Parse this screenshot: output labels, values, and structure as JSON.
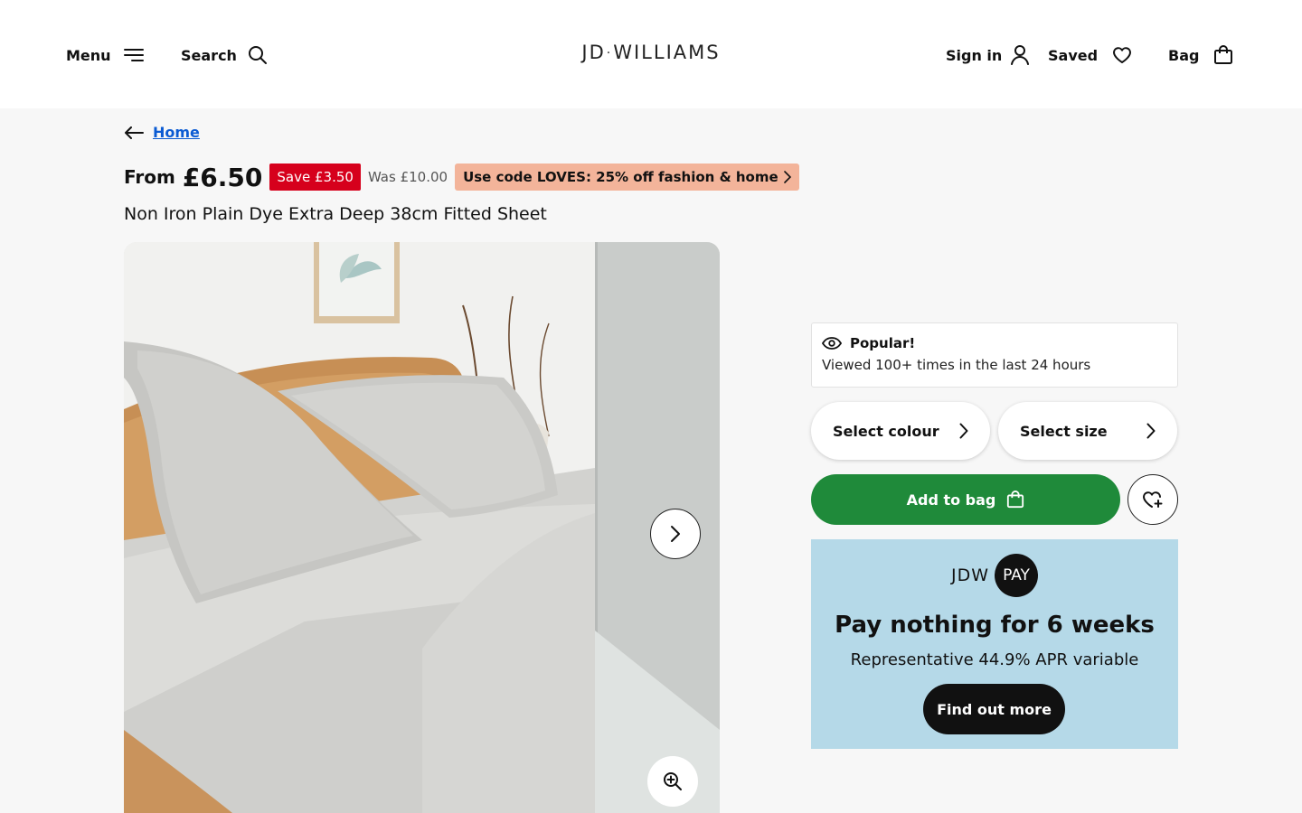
{
  "header": {
    "menu_label": "Menu",
    "search_label": "Search",
    "logo_left": "JD",
    "logo_right": "WILLIAMS",
    "signin_label": "Sign in",
    "saved_label": "Saved",
    "bag_label": "Bag"
  },
  "breadcrumb": {
    "link": "Home"
  },
  "product": {
    "from_label": "From",
    "price": "£6.50",
    "save": "Save £3.50",
    "was": "Was £10.00",
    "promo": "Use code LOVES: 25% off fashion & home",
    "title": "Non Iron Plain Dye Extra Deep 38cm Fitted Sheet"
  },
  "popular": {
    "heading": "Popular!",
    "text": "Viewed 100+ times in the last 24 hours"
  },
  "options": {
    "colour": "Select colour",
    "size": "Select size"
  },
  "actions": {
    "add_to_bag": "Add to bag"
  },
  "pay": {
    "brand_left": "JDW",
    "brand_right": "PAY",
    "heading": "Pay nothing for 6 weeks",
    "sub": "Representative 44.9% APR variable",
    "button": "Find out more"
  },
  "colors": {
    "save_red": "#d6001c",
    "promo_peach": "#f3b49a",
    "add_green": "#1f8a3a",
    "pay_blue": "#b5d9e8",
    "link_blue": "#0b5bd3"
  }
}
